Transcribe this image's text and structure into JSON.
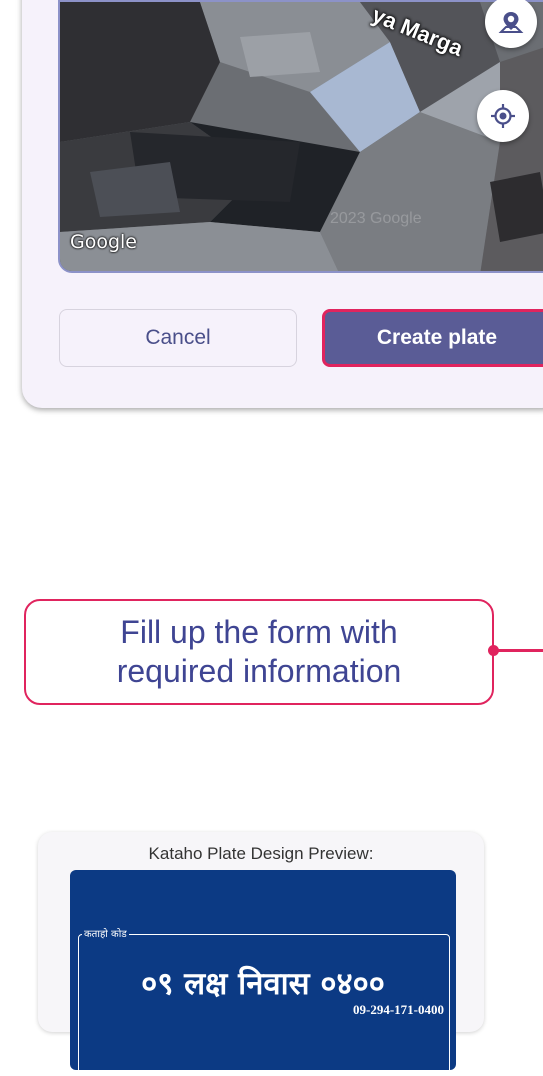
{
  "map": {
    "street_label": "ya Marga",
    "attribution": "Google",
    "watermark": "2023 Google",
    "buttons": [
      {
        "name": "location-pin-icon"
      },
      {
        "name": "my-location-icon"
      }
    ]
  },
  "actions": {
    "cancel_label": "Cancel",
    "create_label": "Create plate"
  },
  "callout": {
    "line1": "Fill up the form with",
    "line2": "required information",
    "accent": "#e0245e"
  },
  "preview": {
    "title": "Kataho Plate Design Preview:",
    "code_label": "कताहो कोड",
    "main_text": "०९ लक्ष निवास ०४००",
    "plate_number": "09-294-171-0400",
    "plate_color": "#0c3a84"
  }
}
